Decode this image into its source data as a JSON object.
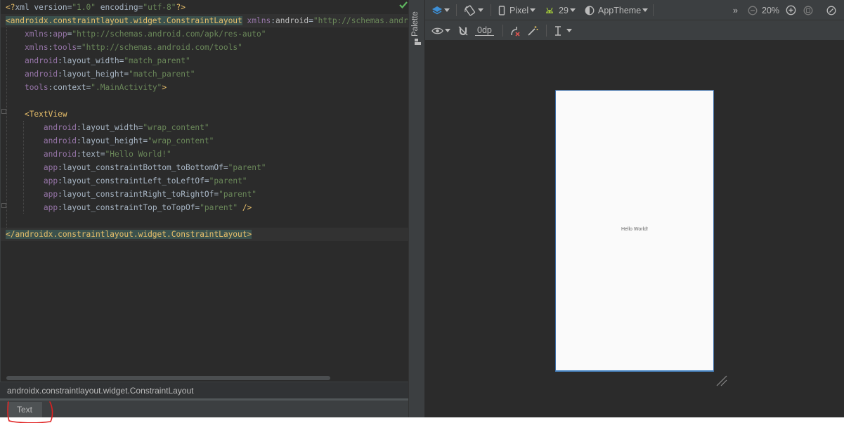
{
  "editor": {
    "lines": [
      [
        {
          "t": "<?",
          "c": "pi"
        },
        {
          "t": "xml version=",
          "c": "def"
        },
        {
          "t": "\"1.0\"",
          "c": "str"
        },
        {
          "t": " encoding=",
          "c": "def"
        },
        {
          "t": "\"utf-8\"",
          "c": "str"
        },
        {
          "t": "?>",
          "c": "pi"
        }
      ],
      [
        {
          "t": "<androidx.constraintlayout.widget.ConstraintLayout",
          "c": "tagbg"
        },
        {
          "t": " ",
          "c": "def"
        },
        {
          "t": "xmlns",
          "c": "ns"
        },
        {
          "t": ":",
          "c": "def"
        },
        {
          "t": "android",
          "c": "attr"
        },
        {
          "t": "=",
          "c": "def"
        },
        {
          "t": "\"http://schemas.android.com/apk/res/android\"",
          "c": "str"
        }
      ],
      [
        {
          "t": "    ",
          "c": "def"
        },
        {
          "t": "xmlns",
          "c": "ns"
        },
        {
          "t": ":",
          "c": "def"
        },
        {
          "t": "app",
          "c": "ns"
        },
        {
          "t": "=",
          "c": "def"
        },
        {
          "t": "\"http://schemas.android.com/apk/res-auto\"",
          "c": "str"
        }
      ],
      [
        {
          "t": "    ",
          "c": "def"
        },
        {
          "t": "xmlns",
          "c": "ns"
        },
        {
          "t": ":",
          "c": "def"
        },
        {
          "t": "tools",
          "c": "ns"
        },
        {
          "t": "=",
          "c": "def"
        },
        {
          "t": "\"http://schemas.android.com/tools\"",
          "c": "str"
        }
      ],
      [
        {
          "t": "    ",
          "c": "def"
        },
        {
          "t": "android",
          "c": "ns"
        },
        {
          "t": ":layout_width=",
          "c": "def"
        },
        {
          "t": "\"match_parent\"",
          "c": "str"
        }
      ],
      [
        {
          "t": "    ",
          "c": "def"
        },
        {
          "t": "android",
          "c": "ns"
        },
        {
          "t": ":layout_height=",
          "c": "def"
        },
        {
          "t": "\"match_parent\"",
          "c": "str"
        }
      ],
      [
        {
          "t": "    ",
          "c": "def"
        },
        {
          "t": "tools",
          "c": "ns"
        },
        {
          "t": ":context=",
          "c": "def"
        },
        {
          "t": "\".MainActivity\"",
          "c": "str"
        },
        {
          "t": ">",
          "c": "tag"
        }
      ],
      [],
      [
        {
          "t": "    ",
          "c": "def"
        },
        {
          "t": "<TextView",
          "c": "tag"
        }
      ],
      [
        {
          "t": "        ",
          "c": "def"
        },
        {
          "t": "android",
          "c": "ns"
        },
        {
          "t": ":layout_width=",
          "c": "def"
        },
        {
          "t": "\"wrap_content\"",
          "c": "str"
        }
      ],
      [
        {
          "t": "        ",
          "c": "def"
        },
        {
          "t": "android",
          "c": "ns"
        },
        {
          "t": ":layout_height=",
          "c": "def"
        },
        {
          "t": "\"wrap_content\"",
          "c": "str"
        }
      ],
      [
        {
          "t": "        ",
          "c": "def"
        },
        {
          "t": "android",
          "c": "ns"
        },
        {
          "t": ":text=",
          "c": "def"
        },
        {
          "t": "\"Hello World!\"",
          "c": "str"
        }
      ],
      [
        {
          "t": "        ",
          "c": "def"
        },
        {
          "t": "app",
          "c": "ns"
        },
        {
          "t": ":layout_constraintBottom_toBottomOf=",
          "c": "def"
        },
        {
          "t": "\"parent\"",
          "c": "str"
        }
      ],
      [
        {
          "t": "        ",
          "c": "def"
        },
        {
          "t": "app",
          "c": "ns"
        },
        {
          "t": ":layout_constraintLeft_toLeftOf=",
          "c": "def"
        },
        {
          "t": "\"parent\"",
          "c": "str"
        }
      ],
      [
        {
          "t": "        ",
          "c": "def"
        },
        {
          "t": "app",
          "c": "ns"
        },
        {
          "t": ":layout_constraintRight_toRightOf=",
          "c": "def"
        },
        {
          "t": "\"parent\"",
          "c": "str"
        }
      ],
      [
        {
          "t": "        ",
          "c": "def"
        },
        {
          "t": "app",
          "c": "ns"
        },
        {
          "t": ":layout_constraintTop_toTopOf=",
          "c": "def"
        },
        {
          "t": "\"parent\"",
          "c": "str"
        },
        {
          "t": " />",
          "c": "tag"
        }
      ],
      [],
      [
        {
          "t": "</androidx.constraintlayout.widget.ConstraintLayout>",
          "c": "tagbg"
        }
      ]
    ],
    "breadcrumb": "androidx.constraintlayout.widget.ConstraintLayout",
    "bottom_tab": "Text"
  },
  "palette": {
    "label": "Palette"
  },
  "toolbar": {
    "device": "Pixel",
    "api_level": "29",
    "theme": "AppTheme",
    "zoom": "20%",
    "margin": "0dp",
    "more": "»"
  },
  "preview": {
    "hello_text": "Hello World!"
  }
}
